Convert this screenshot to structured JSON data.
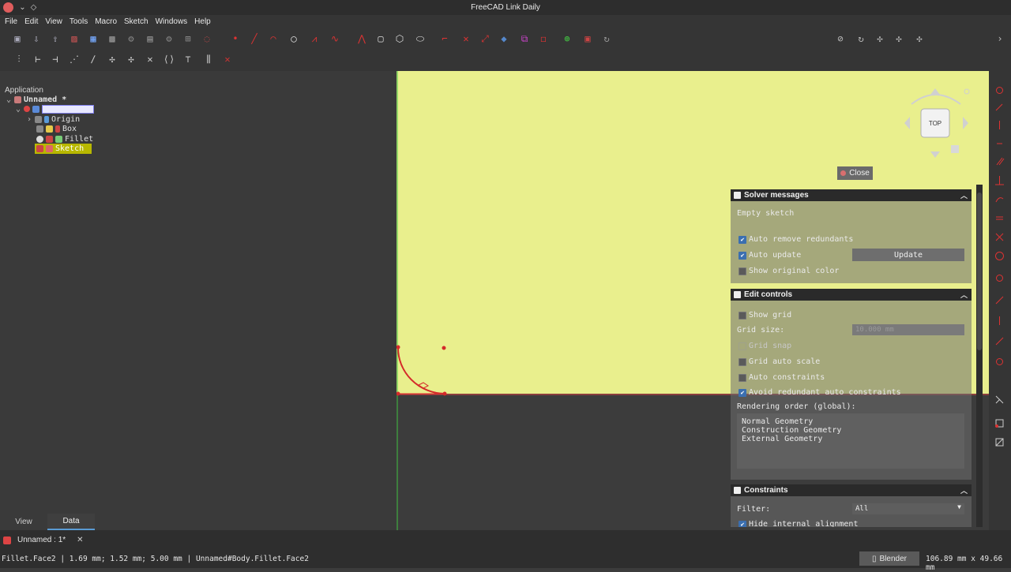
{
  "window": {
    "title": "FreeCAD Link Daily"
  },
  "menubar": {
    "items": [
      "File",
      "Edit",
      "View",
      "Tools",
      "Macro",
      "Sketch",
      "Windows",
      "Help"
    ]
  },
  "tree": {
    "header": "Application",
    "document": "Unnamed *",
    "items": [
      {
        "label": "",
        "selected_editing": true
      },
      {
        "label": "Origin"
      },
      {
        "label": "Box"
      },
      {
        "label": "Fillet"
      },
      {
        "label": "Sketch",
        "highlighted": true
      }
    ]
  },
  "combo_tabs": [
    "View",
    "Data"
  ],
  "active_combo_tab": "Data",
  "navcube": {
    "face_label": "TOP"
  },
  "close_button": "Close",
  "solver_messages": {
    "title": "Solver messages",
    "status": "Empty sketch",
    "auto_remove_redundants": "Auto remove redundants",
    "auto_update": "Auto update",
    "update_button": "Update",
    "show_original_color": "Show original color"
  },
  "edit_controls": {
    "title": "Edit controls",
    "show_grid": "Show grid",
    "grid_size_label": "Grid size:",
    "grid_size_value": "10.000 mm",
    "grid_snap": "Grid snap",
    "grid_auto_scale": "Grid auto scale",
    "auto_constraints": "Auto constraints",
    "avoid_redundant": "Avoid redundant auto constraints",
    "rendering_order_label": "Rendering order (global):",
    "rendering_order": [
      "Normal Geometry",
      "Construction Geometry",
      "External Geometry"
    ]
  },
  "constraints": {
    "title": "Constraints",
    "filter_label": "Filter:",
    "filter_value": "All",
    "hide_internal": "Hide internal alignment"
  },
  "doc_tab": {
    "label": "Unnamed : 1*"
  },
  "statusbar": {
    "message": "Fillet.Face2 | 1.69 mm; 1.52 mm; 5.00 mm | Unnamed#Body.Fillet.Face2",
    "navigation_style": "Blender",
    "dimensions": "106.89 mm x 49.66 mm"
  },
  "colors": {
    "viewport": "#e9ef8d",
    "sketch_red": "#d42a2a",
    "axis_green": "#3fbf3f"
  }
}
